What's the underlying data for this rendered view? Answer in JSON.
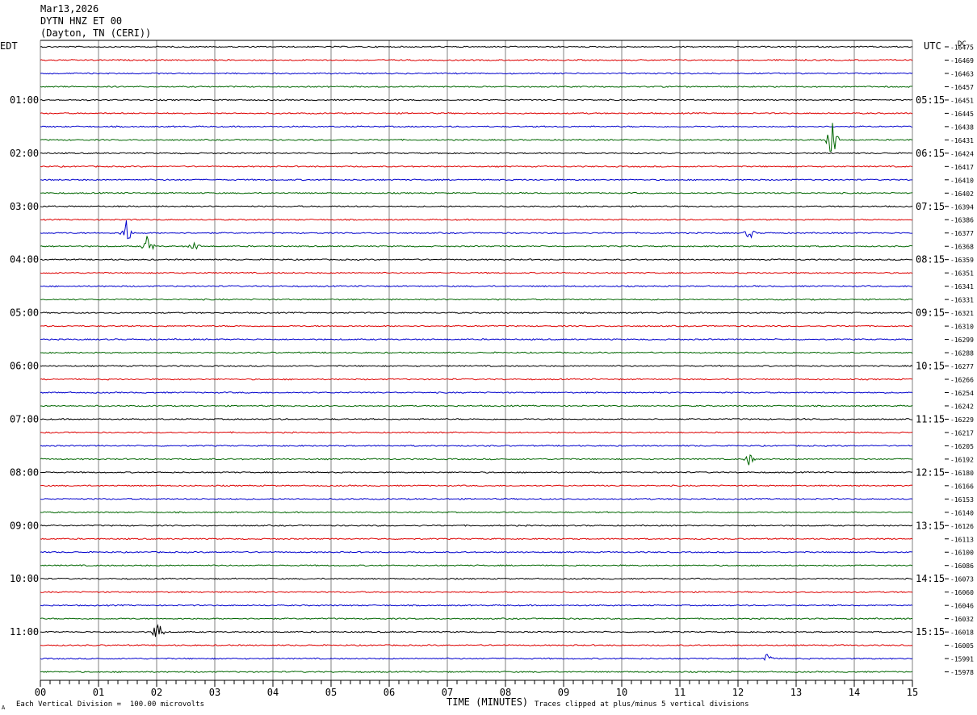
{
  "header": {
    "date": "Mar13,2026",
    "station": "DYTN HNZ ET 00",
    "location": "(Dayton, TN (CERI))"
  },
  "left_timezone": "EDT",
  "right_timezone": "UTC",
  "dc_label": "DC",
  "footer": {
    "scale_note": "Each Vertical Division =  100.00 microvolts",
    "clip_note": "Traces clipped at plus/minus 5 vertical divisions",
    "mark": "A"
  },
  "chart_data": {
    "type": "line",
    "xlabel": "TIME (MINUTES)",
    "xlim": [
      0,
      15
    ],
    "x_ticks": [
      "00",
      "01",
      "02",
      "03",
      "04",
      "05",
      "06",
      "07",
      "08",
      "09",
      "10",
      "11",
      "12",
      "13",
      "14",
      "15"
    ],
    "trace_colors": [
      "#000000",
      "#dd0000",
      "#0000cc",
      "#006600"
    ],
    "grid_color": "#808080",
    "left_hour_labels": [
      "01:00",
      "02:00",
      "03:00",
      "04:00",
      "05:00",
      "06:00",
      "07:00",
      "08:00",
      "09:00",
      "10:00",
      "11:00"
    ],
    "right_hour_labels": [
      "05:15",
      "06:15",
      "07:15",
      "08:15",
      "09:15",
      "10:15",
      "11:15",
      "12:15",
      "13:15",
      "14:15",
      "15:15"
    ],
    "dc_values": [
      "-16475",
      "-16469",
      "-16463",
      "-16457",
      "-16451",
      "-16445",
      "-16438",
      "-16431",
      "-16424",
      "-16417",
      "-16410",
      "-16402",
      "-16394",
      "-16386",
      "-16377",
      "-16368",
      "-16359",
      "-16351",
      "-16341",
      "-16331",
      "-16321",
      "-16310",
      "-16299",
      "-16288",
      "-16277",
      "-16266",
      "-16254",
      "-16242",
      "-16229",
      "-16217",
      "-16205",
      "-16192",
      "-16180",
      "-16166",
      "-16153",
      "-16140",
      "-16126",
      "-16113",
      "-16100",
      "-16086",
      "-16073",
      "-16060",
      "-16046",
      "-16032",
      "-16018",
      "-16005",
      "-15991",
      "-15978"
    ],
    "events": [
      {
        "trace": 7,
        "minute": 13.62,
        "amplitude": 5
      },
      {
        "trace": 14,
        "minute": 1.48,
        "amplitude": 3.2
      },
      {
        "trace": 14,
        "minute": 12.2,
        "amplitude": 1.2
      },
      {
        "trace": 15,
        "minute": 1.85,
        "amplitude": 2.6
      },
      {
        "trace": 15,
        "minute": 2.65,
        "amplitude": 0.9
      },
      {
        "trace": 31,
        "minute": 12.2,
        "amplitude": 1.1
      },
      {
        "trace": 44,
        "minute": 2.02,
        "amplitude": 2.8
      },
      {
        "trace": 46,
        "minute": 12.5,
        "amplitude": 1.0
      }
    ]
  }
}
